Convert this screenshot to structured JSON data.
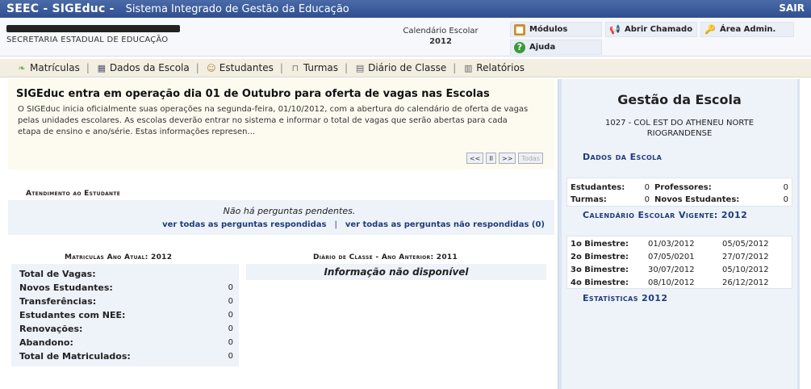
{
  "topbar": {
    "brand": "SEEC - SIGEduc -",
    "subtitle": "Sistema Integrado de Gestão da Educação",
    "logout": "SAIR"
  },
  "header": {
    "secretaria": "SECRETARIA ESTADUAL DE EDUCAÇÃO",
    "calendar_label": "Calendário Escolar",
    "calendar_year": "2012",
    "buttons": {
      "modulos": "Módulos",
      "abrir_chamado": "Abrir Chamado",
      "area_admin": "Área Admin.",
      "ajuda": "Ajuda"
    }
  },
  "nav": {
    "items": [
      "Matrículas",
      "Dados da Escola",
      "Estudantes",
      "Turmas",
      "Diário de Classe",
      "Relatórios"
    ]
  },
  "news": {
    "title": "SIGEduc entra em operação dia 01 de Outubro para oferta de vagas nas Escolas",
    "body": "O SIGEduc inicia oficialmente suas operações na segunda-feira, 01/10/2012, com a abertura do calendário de oferta de vagas pelas unidades escolares. As escolas deverão entrar no sistema e informar o total de vagas que serão abertas para cada etapa de ensino e ano/série. Estas informações represen...",
    "controls": {
      "prev": "<<",
      "pause": "II",
      "next": ">>",
      "all": "Todas"
    }
  },
  "atendimento": {
    "caption": "Atendimento ao Estudante",
    "message": "Não há perguntas pendentes.",
    "link_answered": "ver todas as perguntas respondidas",
    "link_unanswered": "ver todas as perguntas não respondidas (0)"
  },
  "matriculas": {
    "caption": "Matriculas Ano Atual: 2012",
    "rows": [
      {
        "label": "Total de Vagas:",
        "value": ""
      },
      {
        "label": "Novos Estudantes:",
        "value": "0"
      },
      {
        "label": "Transferências:",
        "value": "0"
      },
      {
        "label": "Estudantes com NEE:",
        "value": "0"
      },
      {
        "label": "Renovações:",
        "value": "0"
      },
      {
        "label": "Abandono:",
        "value": "0"
      },
      {
        "label": "Total de Matriculados:",
        "value": "0"
      }
    ]
  },
  "diario": {
    "caption": "Diário de Classe - Ano Anterior: 2011",
    "message": "Informação não disponível"
  },
  "gestao": {
    "title": "Gestão da Escola",
    "school": "1027 - COL EST DO ATHENEU NORTE RIOGRANDENSE",
    "dados_heading": "Dados da Escola",
    "stats": {
      "estudantes_label": "Estudantes:",
      "estudantes": "0",
      "professores_label": "Professores:",
      "professores": "0",
      "turmas_label": "Turmas:",
      "turmas": "0",
      "novos_label": "Novos Estudantes:",
      "novos": "0"
    },
    "calendario_heading": "Calendário Escolar Vigente: 2012",
    "bimestres": [
      {
        "label": "1o Bimestre:",
        "start": "01/03/2012",
        "end": "05/05/2012"
      },
      {
        "label": "2o Bimestre:",
        "start": "07/05/0201",
        "end": "27/07/2012"
      },
      {
        "label": "3o Bimestre:",
        "start": "30/07/2012",
        "end": "05/10/2012"
      },
      {
        "label": "4o Bimestre:",
        "start": "08/10/2012",
        "end": "26/12/2012"
      }
    ],
    "estatisticas_heading": "Estatísticas 2012"
  }
}
